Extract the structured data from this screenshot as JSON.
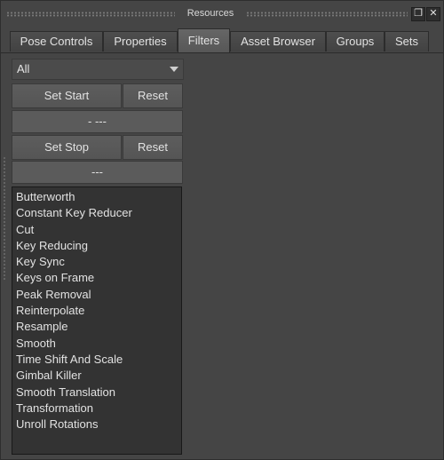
{
  "window": {
    "title": "Resources"
  },
  "tabs": [
    {
      "label": "Pose Controls"
    },
    {
      "label": "Properties"
    },
    {
      "label": "Filters",
      "active": true
    },
    {
      "label": "Asset Browser"
    },
    {
      "label": "Groups"
    },
    {
      "label": "Sets"
    }
  ],
  "filter_select": {
    "value": "All"
  },
  "start": {
    "set_label": "Set Start",
    "reset_label": "Reset",
    "value": "- ---"
  },
  "stop": {
    "set_label": "Set Stop",
    "reset_label": "Reset",
    "value": "---"
  },
  "filters_list": [
    "Butterworth",
    "Constant Key Reducer",
    "Cut",
    "Key Reducing",
    "Key Sync",
    "Keys on Frame",
    "Peak Removal",
    "Reinterpolate",
    "Resample",
    "Smooth",
    "Time Shift And Scale",
    "Gimbal Killer",
    "Smooth Translation",
    "Transformation",
    "Unroll Rotations"
  ]
}
